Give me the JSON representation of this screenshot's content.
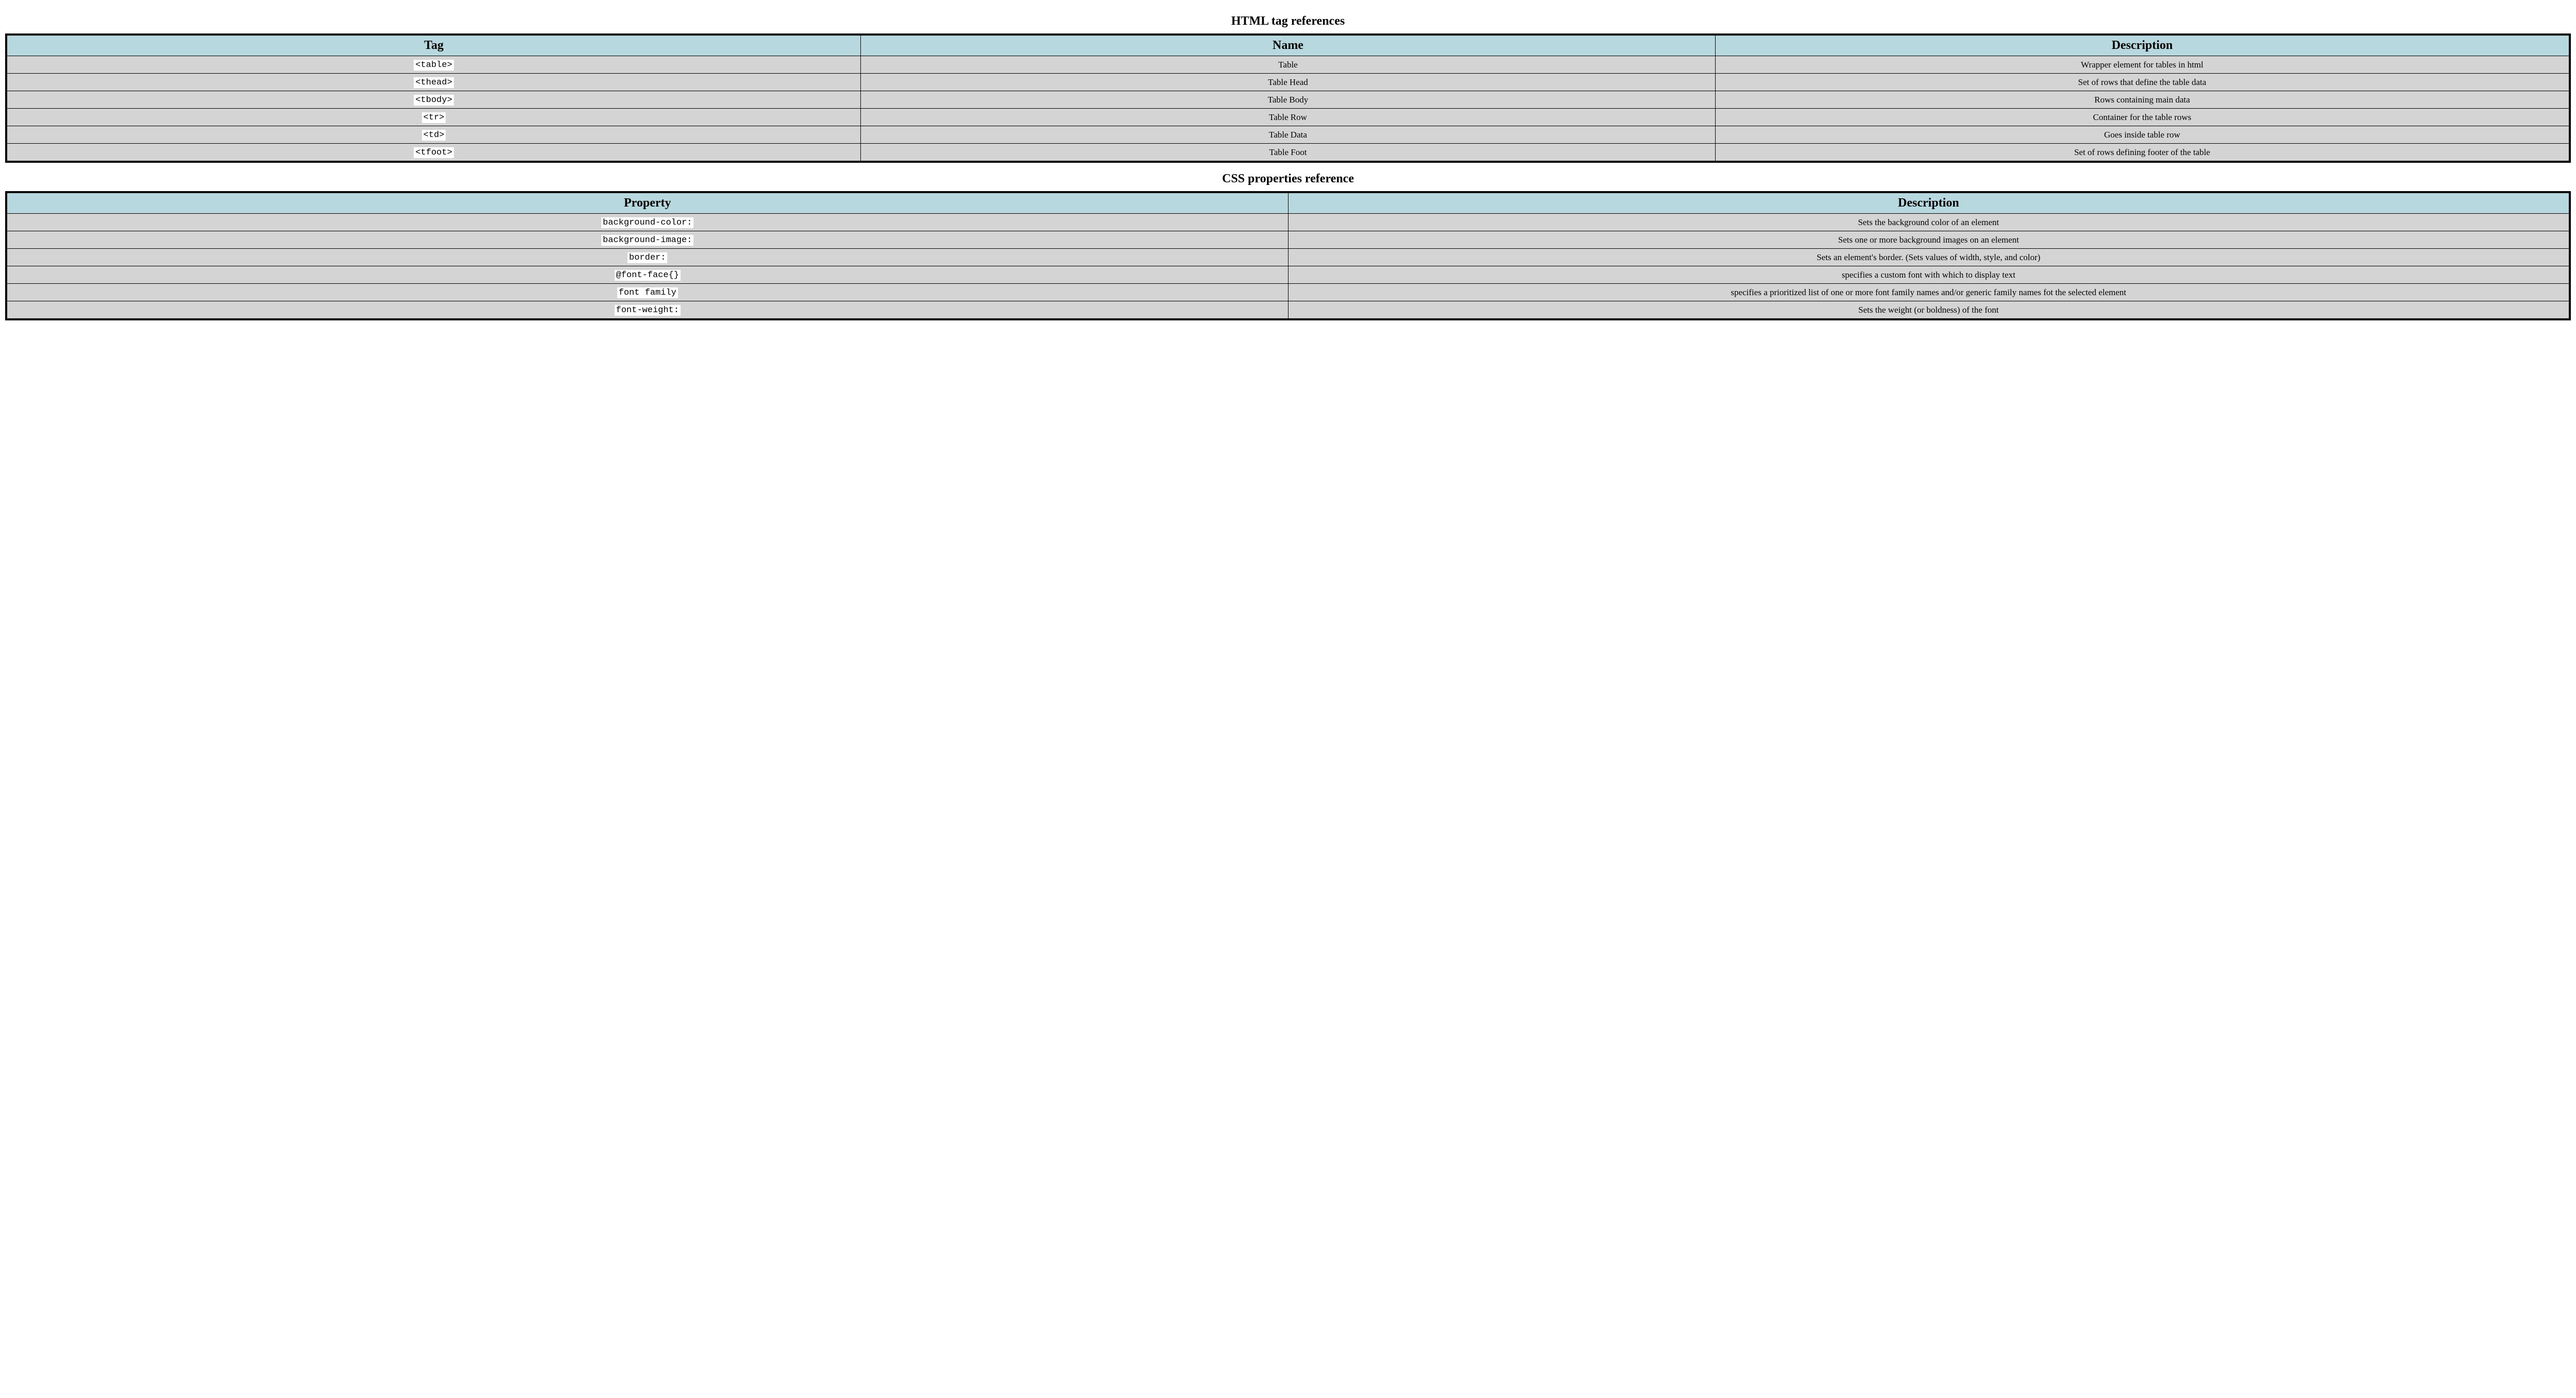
{
  "table1": {
    "caption": "HTML tag references",
    "headers": [
      "Tag",
      "Name",
      "Description"
    ],
    "rows": [
      {
        "tag": "<table>",
        "name": "Table",
        "desc": "Wrapper element for tables in html"
      },
      {
        "tag": "<thead>",
        "name": "Table Head",
        "desc": "Set of rows that define the table data"
      },
      {
        "tag": "<tbody>",
        "name": "Table Body",
        "desc": "Rows containing main data"
      },
      {
        "tag": "<tr>",
        "name": "Table Row",
        "desc": "Container for the table rows"
      },
      {
        "tag": "<td>",
        "name": "Table Data",
        "desc": "Goes inside table row"
      },
      {
        "tag": "<tfoot>",
        "name": "Table Foot",
        "desc": "Set of rows defining footer of the table"
      }
    ]
  },
  "table2": {
    "caption": "CSS properties reference",
    "headers": [
      "Property",
      "Description"
    ],
    "rows": [
      {
        "prop": "background-color:",
        "desc": "Sets the background color of an element"
      },
      {
        "prop": "background-image:",
        "desc": "Sets one or more background images on an element"
      },
      {
        "prop": "border:",
        "desc": "Sets an element's border. (Sets values of width, style, and color)"
      },
      {
        "prop": "@font-face{}",
        "desc": "specifies a custom font with which to display text"
      },
      {
        "prop": "font family",
        "desc": "specifies a prioritized list of one or more font family names and/or generic family names fot the selected element"
      },
      {
        "prop": "font-weight:",
        "desc": "Sets the weight (or boldness) of the font"
      }
    ]
  }
}
